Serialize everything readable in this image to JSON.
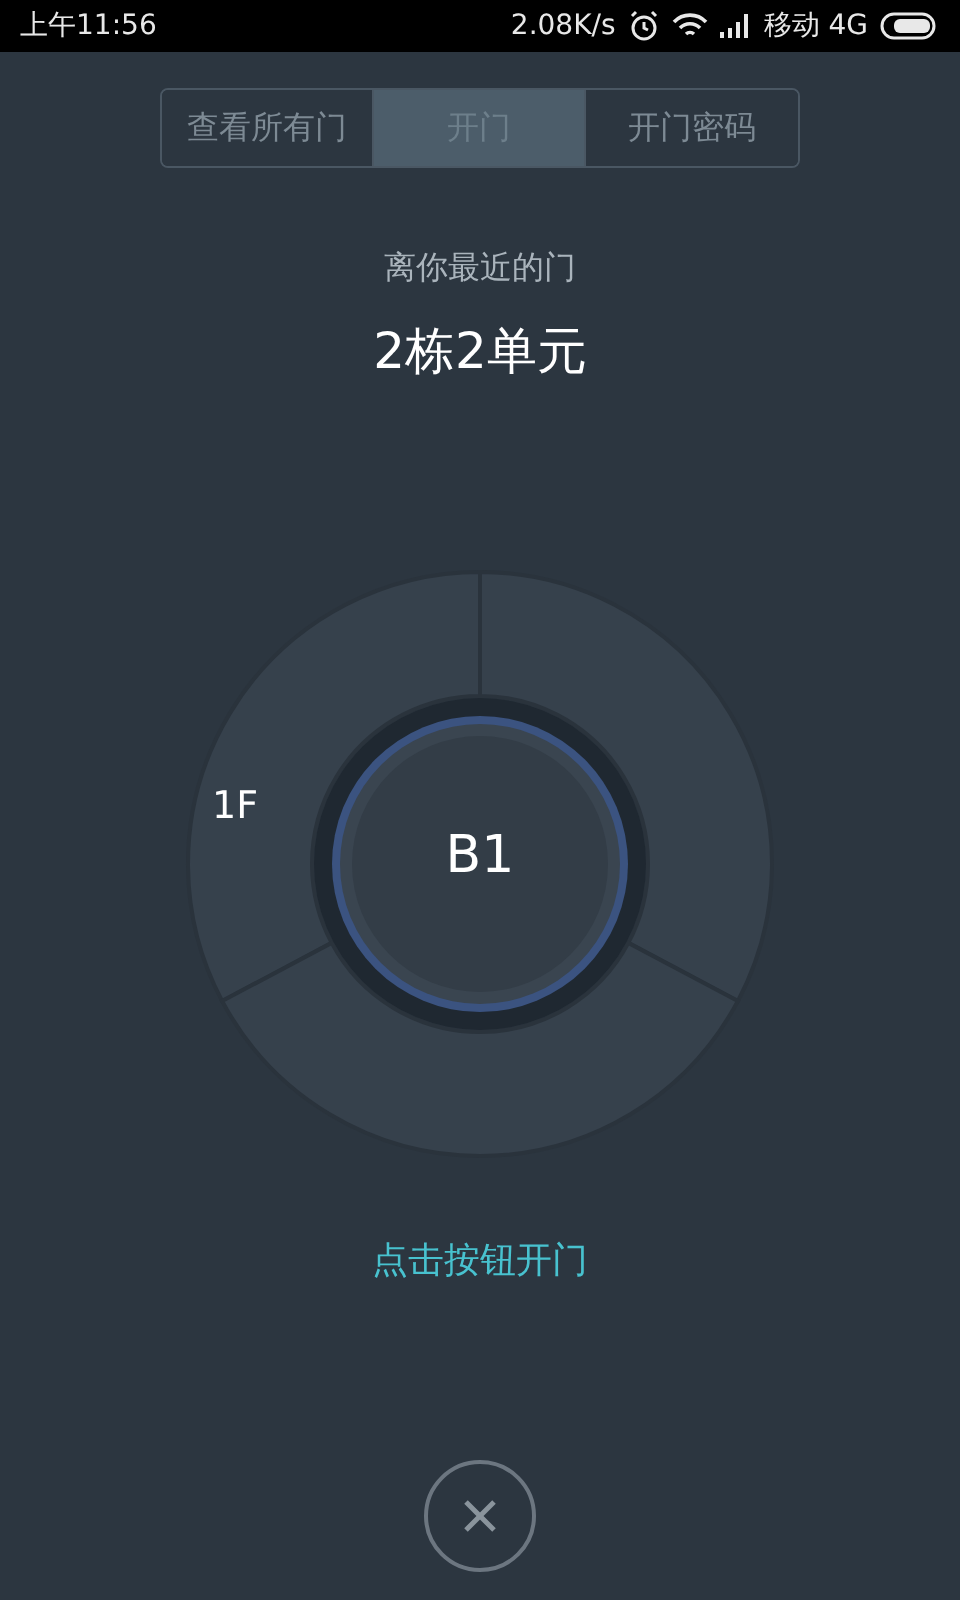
{
  "status_bar": {
    "time": "上午11:56",
    "speed": "2.08K/s",
    "carrier": "移动 4G"
  },
  "tabs": [
    {
      "label": "查看所有门",
      "selected": false
    },
    {
      "label": "开门",
      "selected": true
    },
    {
      "label": "开门密码",
      "selected": false
    }
  ],
  "nearest_label": "离你最近的门",
  "door_name": "2栋2单元",
  "wheel": {
    "floor_label": "1F",
    "center_button": "B1"
  },
  "hint": "点击按钮开门"
}
